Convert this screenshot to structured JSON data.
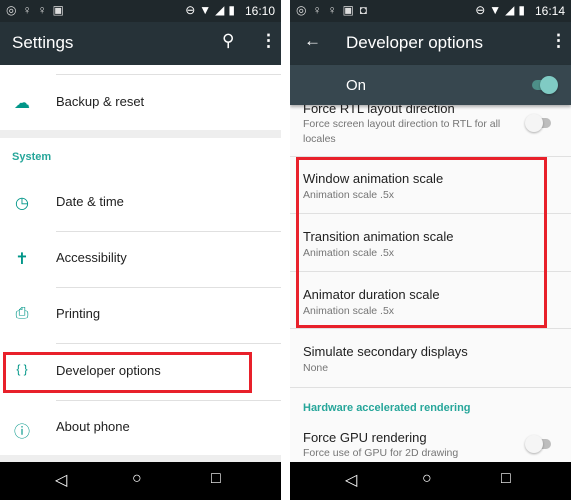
{
  "left": {
    "status_time": "16:10",
    "title": "Settings",
    "backup": "Backup & reset",
    "system_header": "System",
    "items": [
      {
        "label": "Date & time",
        "icon": "clock-icon"
      },
      {
        "label": "Accessibility",
        "icon": "accessibility-icon"
      },
      {
        "label": "Printing",
        "icon": "printer-icon"
      },
      {
        "label": "Developer options",
        "icon": "braces-icon"
      },
      {
        "label": "About phone",
        "icon": "info-icon"
      }
    ]
  },
  "right": {
    "status_time": "16:14",
    "title": "Developer options",
    "master": "On",
    "master_on": true,
    "items": [
      {
        "title": "Force RTL layout direction",
        "summary": "Force screen layout direction to RTL for all locales",
        "toggle": false
      },
      {
        "title": "Window animation scale",
        "summary": "Animation scale .5x"
      },
      {
        "title": "Transition animation scale",
        "summary": "Animation scale .5x"
      },
      {
        "title": "Animator duration scale",
        "summary": "Animation scale .5x"
      },
      {
        "title": "Simulate secondary displays",
        "summary": "None"
      }
    ],
    "hw_header": "Hardware accelerated rendering",
    "gpu": {
      "title": "Force GPU rendering",
      "summary": "Force use of GPU for 2D drawing",
      "toggle": false
    }
  },
  "colors": {
    "accent": "#009688",
    "highlight": "#e8202a",
    "toolbar": "#263238"
  }
}
